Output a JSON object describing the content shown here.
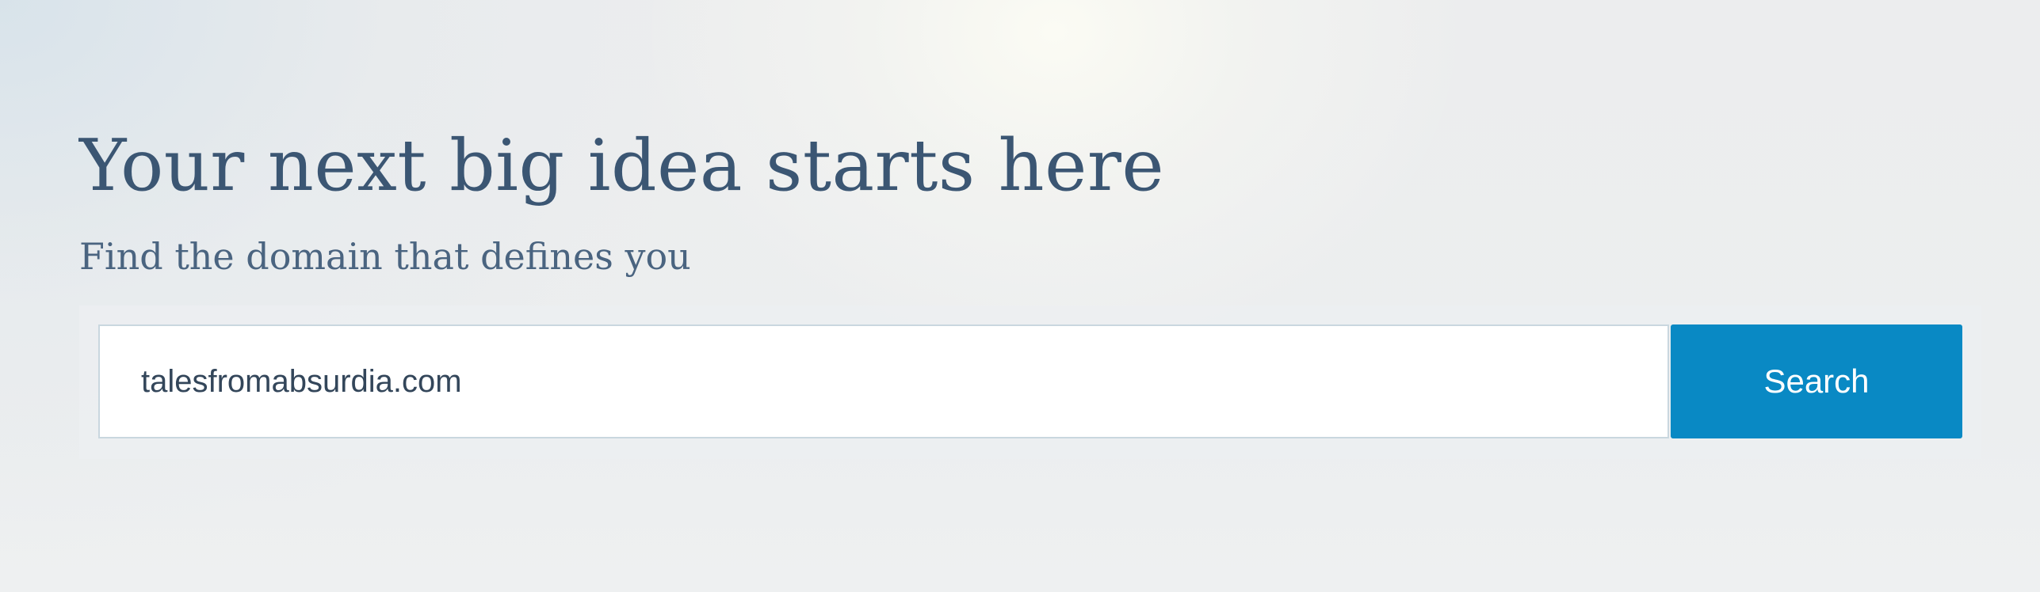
{
  "hero": {
    "headline": "Your next big idea starts here",
    "subheadline": "Find the domain that defines you"
  },
  "search": {
    "value": "talesfromabsurdia.com",
    "button_label": "Search"
  },
  "colors": {
    "heading_text": "#3b5673",
    "button_background": "#0989c4",
    "button_text": "#ffffff",
    "input_border": "#c9d7df"
  }
}
